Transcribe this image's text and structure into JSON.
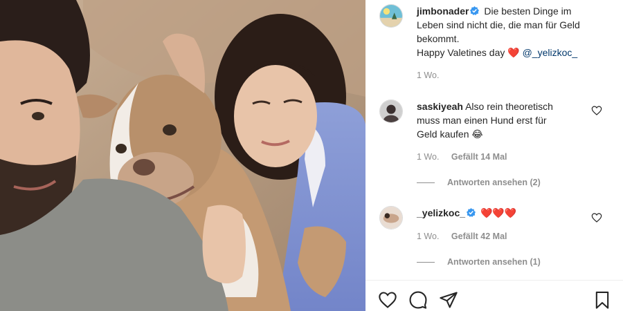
{
  "post": {
    "author": "jimbonader",
    "caption_line1": "Die besten Dinge im",
    "caption_line2": "Leben sind nicht die, die man für Geld",
    "caption_line3": "bekommt.",
    "caption_line4": "Happy Valetines day",
    "caption_heart": "❤️",
    "mention": "@_yelizkoc_",
    "time": "1 Wo."
  },
  "comments": [
    {
      "user": "saskiyeah",
      "text_line1": "Also rein theoretisch",
      "text_line2": "muss man einen Hund erst für",
      "text_line3": "Geld kaufen",
      "emoji": "😂",
      "time": "1 Wo.",
      "likes": "Gefällt 14 Mal",
      "replies": "Antworten ansehen (2)"
    },
    {
      "user": "_yelizkoc_",
      "text_line1": "❤️❤️❤️",
      "time": "1 Wo.",
      "likes": "Gefällt 42 Mal",
      "replies": "Antworten ansehen (1)"
    }
  ],
  "icons": {
    "like": "heart-outline-icon",
    "comment": "comment-bubble-icon",
    "share": "paper-plane-icon",
    "save": "bookmark-icon",
    "verified": "verified-badge-icon"
  },
  "colors": {
    "verified": "#3897f0",
    "mention": "#00376b",
    "heart": "#e0245e",
    "meta": "#8e8e8e"
  }
}
